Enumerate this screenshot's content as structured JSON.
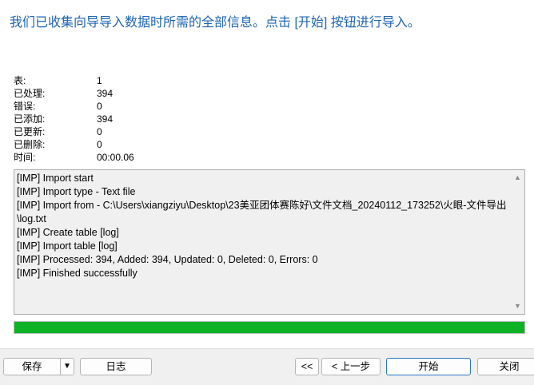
{
  "heading": "我们已收集向导导入数据时所需的全部信息。点击 [开始] 按钮进行导入。",
  "stats": [
    {
      "label": "表:",
      "value": "1"
    },
    {
      "label": "已处理:",
      "value": "394"
    },
    {
      "label": "错误:",
      "value": "0"
    },
    {
      "label": "已添加:",
      "value": "394"
    },
    {
      "label": "已更新:",
      "value": "0"
    },
    {
      "label": "已删除:",
      "value": "0"
    },
    {
      "label": "时间:",
      "value": "00:00.06"
    }
  ],
  "log_lines": [
    "[IMP] Import start",
    "[IMP] Import type - Text file",
    "[IMP] Import from - C:\\Users\\xiangziyu\\Desktop\\23美亚团体赛陈好\\文件文档_20240112_173252\\火眼-文件导出\\log.txt",
    "[IMP] Create table [log]",
    "[IMP] Import table [log]",
    "[IMP] Processed: 394, Added: 394, Updated: 0, Deleted: 0, Errors: 0",
    "[IMP] Finished successfully"
  ],
  "progress": {
    "percent": 100,
    "color": "#0eb224"
  },
  "buttons": {
    "save": "保存",
    "save_arrow": "▼",
    "log": "日志",
    "first": "<<",
    "prev": "< 上一步",
    "start": "开始",
    "close": "关闭"
  },
  "icons": {
    "scroll_up": "scroll-up-arrow",
    "scroll_down": "scroll-down-arrow"
  },
  "colors": {
    "heading": "#1d64b5",
    "progress": "#0eb224",
    "primary_border": "#2a78c6"
  }
}
